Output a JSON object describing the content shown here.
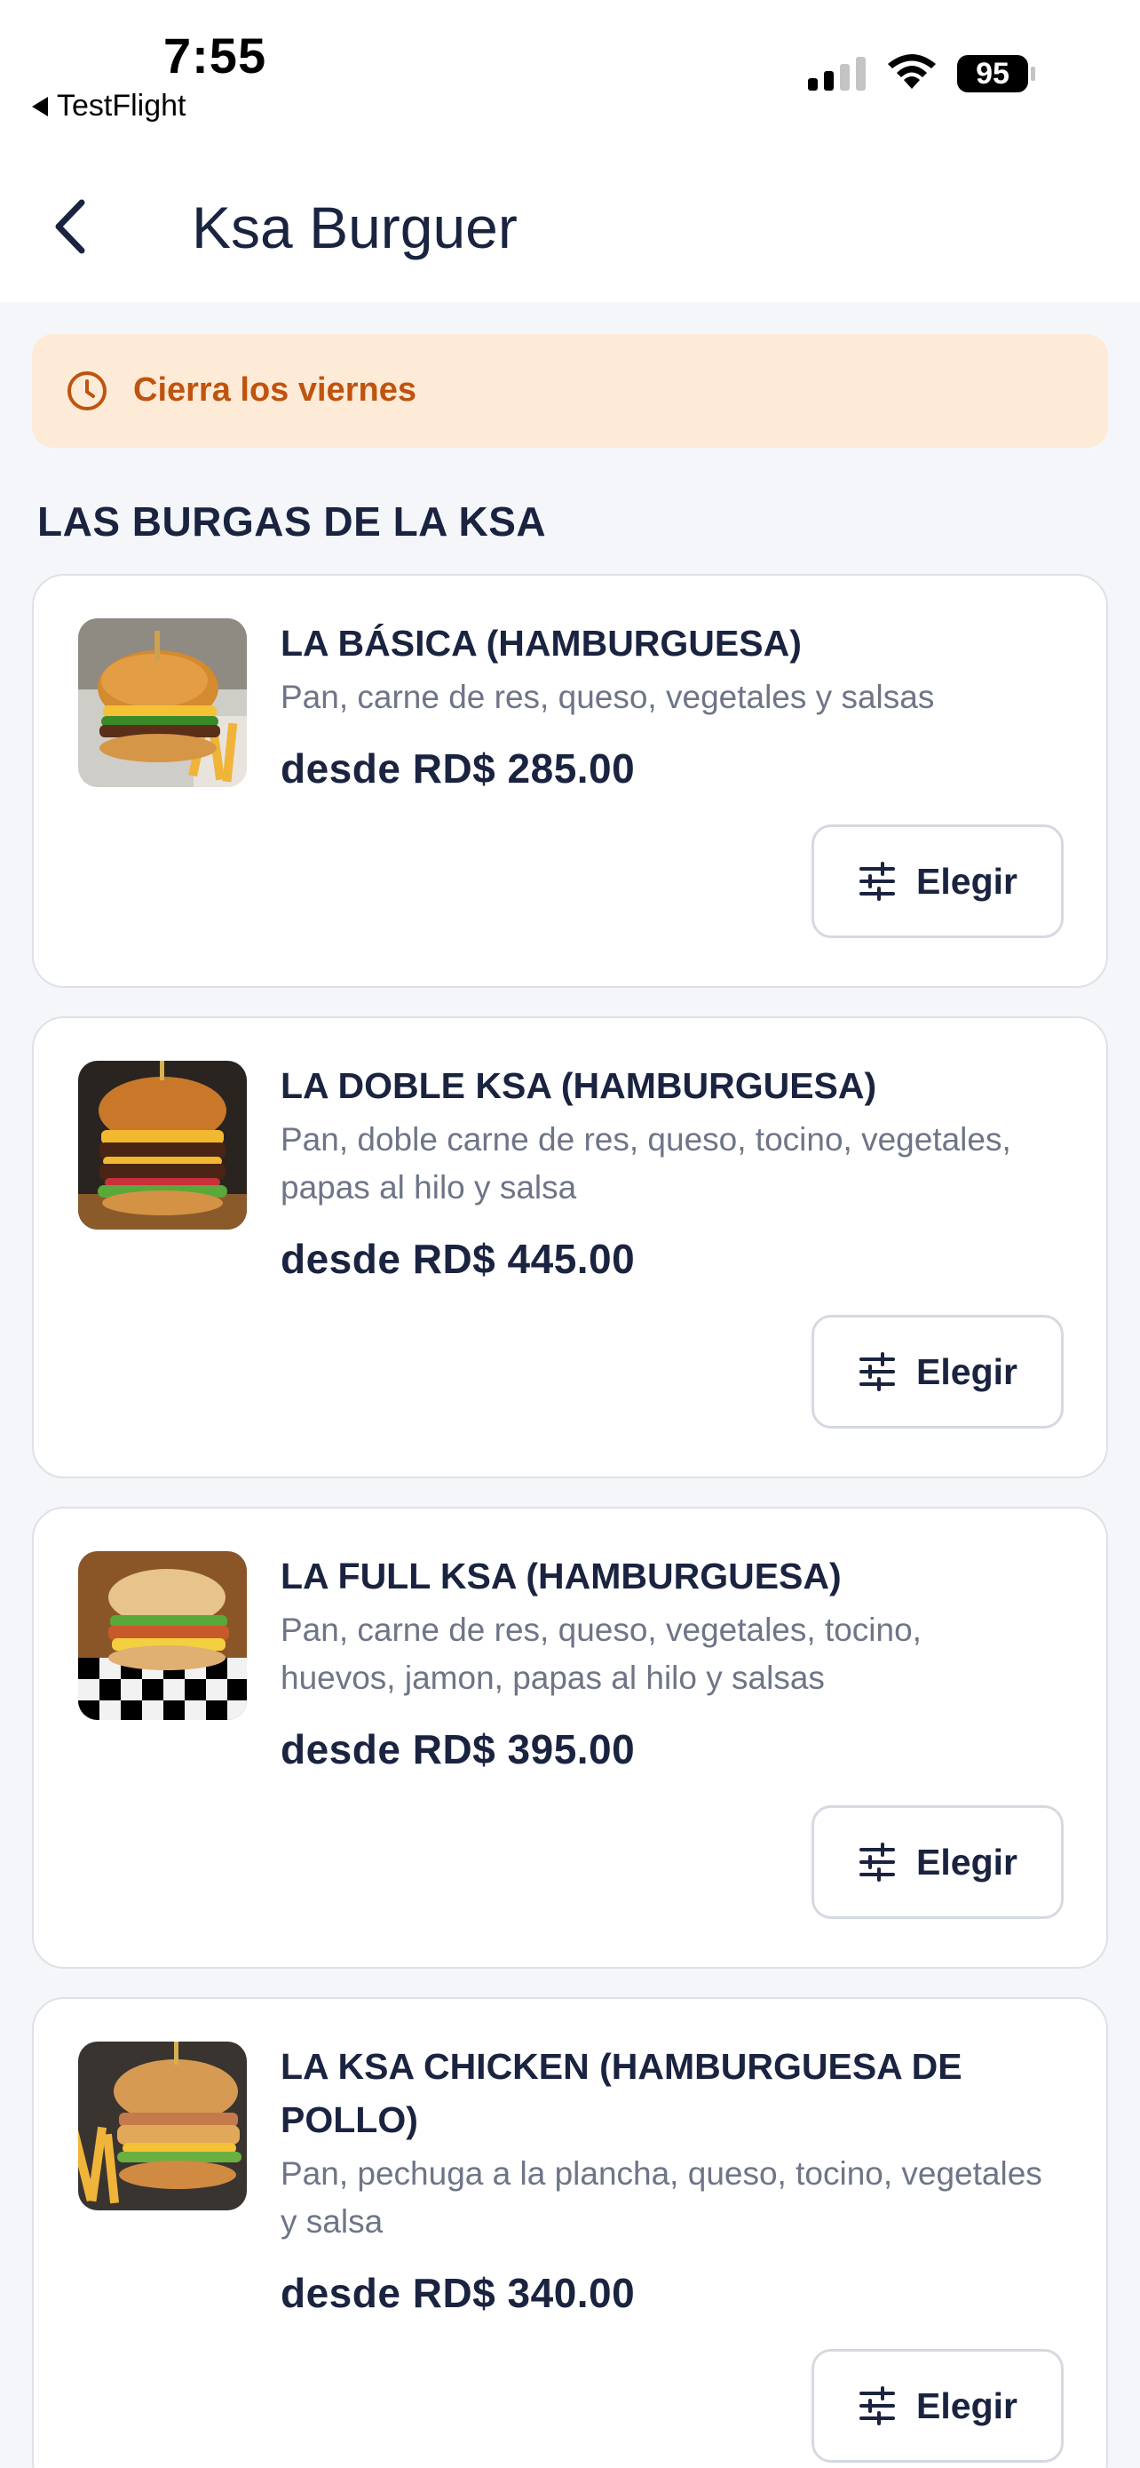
{
  "status_bar": {
    "time": "7:55",
    "back_app": "TestFlight",
    "battery": "95"
  },
  "header": {
    "title": "Ksa Burguer"
  },
  "notice": {
    "text": "Cierra los viernes",
    "color": "#c0530e",
    "background": "#fdebd8"
  },
  "section": {
    "title": "LAS BURGAS DE LA KSA"
  },
  "products": [
    {
      "name": "LA BÁSICA (HAMBURGUESA)",
      "description": "Pan, carne de res, queso, vegetales y salsas",
      "price": "desde RD$ 285.00",
      "button_label": "Elegir"
    },
    {
      "name": "LA DOBLE KSA (HAMBURGUESA)",
      "description": "Pan, doble carne de res, queso, tocino, vegetales, papas al hilo y salsa",
      "price": "desde RD$ 445.00",
      "button_label": "Elegir"
    },
    {
      "name": "LA FULL KSA (HAMBURGUESA)",
      "description": "Pan, carne de res, queso, vegetales, tocino, huevos, jamon, papas al hilo y salsas",
      "price": "desde RD$ 395.00",
      "button_label": "Elegir"
    },
    {
      "name": "LA KSA CHICKEN (HAMBURGUESA DE POLLO)",
      "description": "Pan, pechuga a la plancha, queso, tocino, vegetales y salsa",
      "price": "desde RD$ 340.00",
      "button_label": "Elegir"
    }
  ]
}
